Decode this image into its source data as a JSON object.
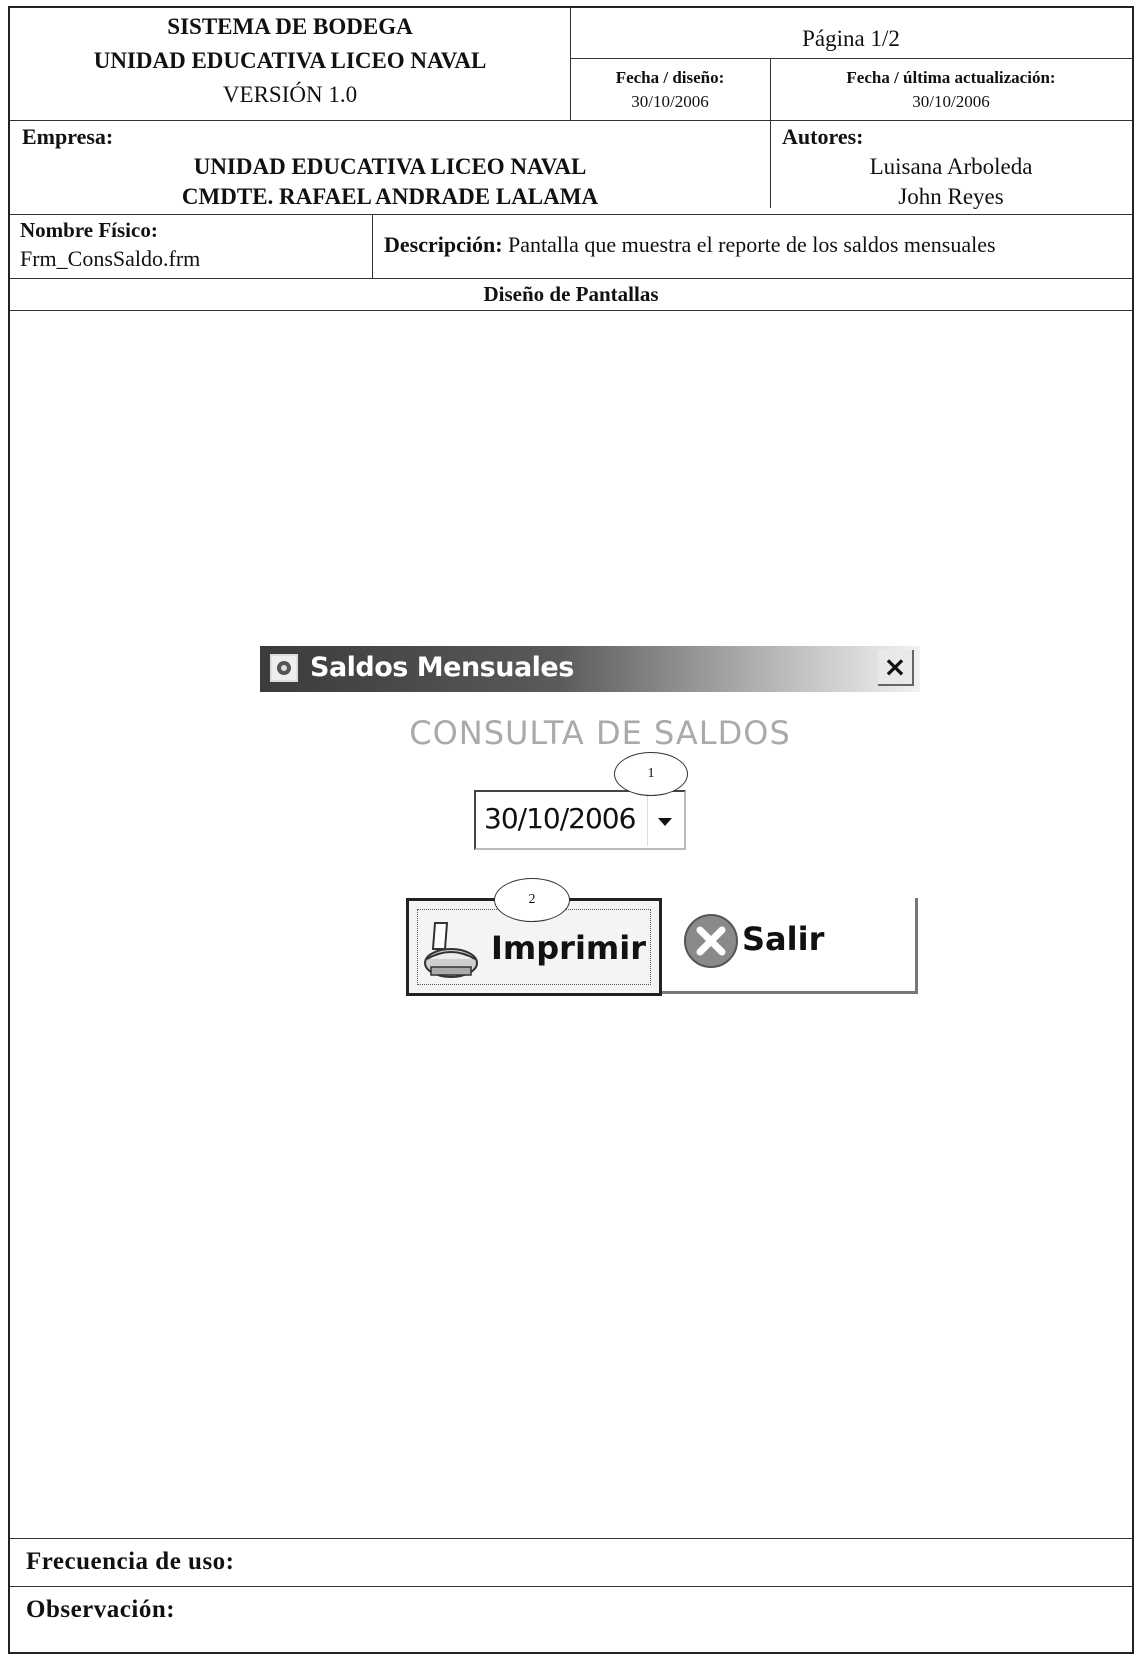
{
  "header": {
    "system_line1": "SISTEMA DE BODEGA",
    "system_line2": "UNIDAD EDUCATIVA LICEO NAVAL",
    "version": "VERSIÓN 1.0",
    "page": "Página 1/2",
    "design_date_label": "Fecha / diseño:",
    "design_date": "30/10/2006",
    "update_date_label": "Fecha / última actualización:",
    "update_date": "30/10/2006"
  },
  "company": {
    "label": "Empresa:",
    "line1": "UNIDAD EDUCATIVA LICEO NAVAL",
    "line2": "CMDTE. RAFAEL ANDRADE LALAMA"
  },
  "authors": {
    "label": "Autores:",
    "names": [
      "Luisana Arboleda",
      "John Reyes"
    ]
  },
  "physical_name": {
    "label": "Nombre Físico:",
    "value": "Frm_ConsSaldo.frm"
  },
  "description": {
    "label": "Descripción:",
    "value": "Pantalla que muestra el reporte de los saldos mensuales"
  },
  "section_title": "Diseño de Pantallas",
  "dialog": {
    "title": "Saldos Mensuales",
    "close_glyph": "×",
    "heading": "CONSULTA DE SALDOS",
    "date_value": "30/10/2006",
    "print_label": "Imprimir",
    "exit_label": "Salir",
    "callouts": [
      "1",
      "2"
    ]
  },
  "footer": {
    "frequency_label": "Frecuencia de uso:",
    "observation_label": "Observación:"
  },
  "icons": {
    "app": "window-app-icon",
    "close": "close-icon",
    "dropdown": "chevron-down-icon",
    "printer": "printer-icon",
    "exit": "exit-x-icon"
  }
}
